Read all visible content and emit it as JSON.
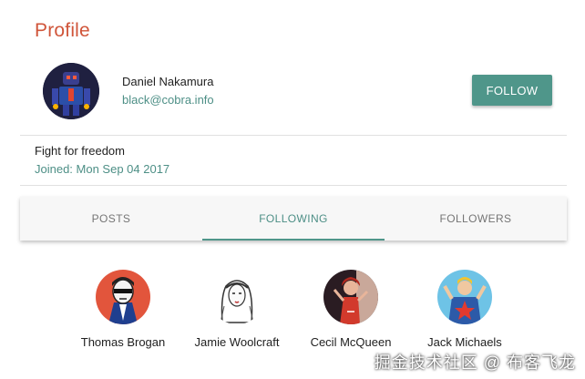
{
  "page": {
    "title": "Profile"
  },
  "user": {
    "name": "Daniel Nakamura",
    "email": "black@cobra.info",
    "bio": "Fight for freedom",
    "joined": "Joined: Mon Sep 04 2017",
    "avatar_icon": "robot-avatar"
  },
  "actions": {
    "follow_label": "FOLLOW"
  },
  "tabs": [
    {
      "label": "POSTS",
      "active": false
    },
    {
      "label": "FOLLOWING",
      "active": true
    },
    {
      "label": "FOLLOWERS",
      "active": false
    }
  ],
  "following": [
    {
      "name": "Thomas Brogan",
      "avatar_icon": "sunglasses-man-avatar"
    },
    {
      "name": "Jamie Woolcraft",
      "avatar_icon": "sketch-woman-avatar"
    },
    {
      "name": "Cecil McQueen",
      "avatar_icon": "red-heroine-avatar"
    },
    {
      "name": "Jack Michaels",
      "avatar_icon": "star-hero-avatar"
    }
  ],
  "colors": {
    "title": "#d0553a",
    "accent": "#4f968a",
    "secondary_text": "#4d8f86"
  },
  "watermark": "掘金技术社区 @ 布客飞龙"
}
